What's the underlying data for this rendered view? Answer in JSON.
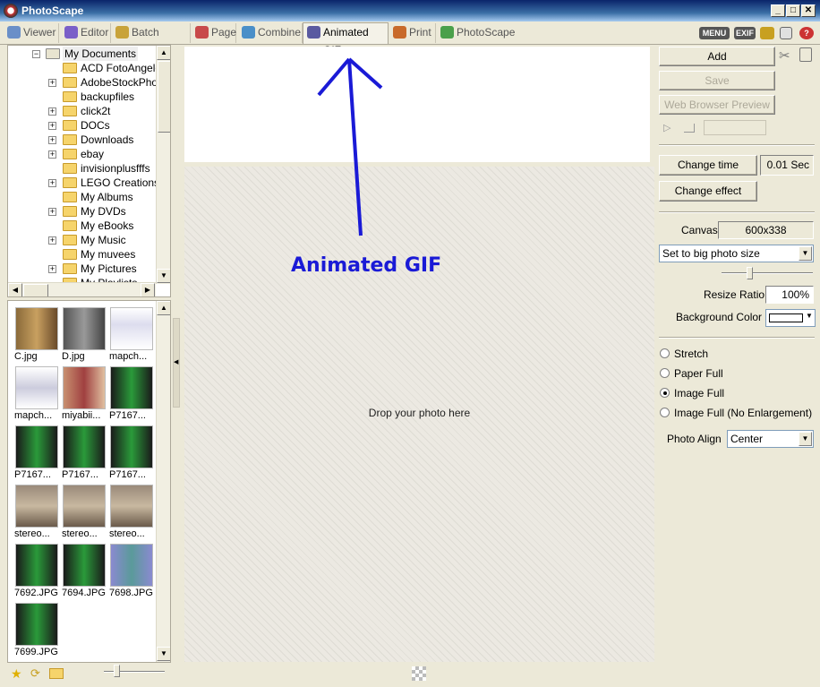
{
  "window": {
    "title": "PhotoScape"
  },
  "tabs": [
    {
      "label": "Viewer",
      "color": "#6a8fc8"
    },
    {
      "label": "Editor",
      "color": "#7a5fc8"
    },
    {
      "label": "Batch Editor",
      "color": "#c8a33a"
    },
    {
      "label": "Page",
      "color": "#c84a4a"
    },
    {
      "label": "Combine",
      "color": "#4a8fc8"
    },
    {
      "label": "Animated GIF",
      "color": "#5a5aa0"
    },
    {
      "label": "Print",
      "color": "#c86a2a"
    },
    {
      "label": "PhotoScape",
      "color": "#4aa04a"
    }
  ],
  "toolbar_icons": {
    "menu": "MENU",
    "exif": "EXIF"
  },
  "tree": {
    "root": "My Documents",
    "items": [
      {
        "label": "ACD FotoAngelo",
        "expandable": false
      },
      {
        "label": "AdobeStockPho",
        "expandable": true
      },
      {
        "label": "backupfiles",
        "expandable": false
      },
      {
        "label": "click2t",
        "expandable": true
      },
      {
        "label": "DOCs",
        "expandable": true
      },
      {
        "label": "Downloads",
        "expandable": true
      },
      {
        "label": "ebay",
        "expandable": true
      },
      {
        "label": "invisionplusfffs",
        "expandable": false
      },
      {
        "label": "LEGO Creations",
        "expandable": true
      },
      {
        "label": "My Albums",
        "expandable": false
      },
      {
        "label": "My DVDs",
        "expandable": true
      },
      {
        "label": "My eBooks",
        "expandable": false
      },
      {
        "label": "My Music",
        "expandable": true
      },
      {
        "label": "My muvees",
        "expandable": false
      },
      {
        "label": "My Pictures",
        "expandable": true
      },
      {
        "label": "My Playlists",
        "expandable": false
      }
    ]
  },
  "thumbnails": [
    {
      "caption": "C.jpg"
    },
    {
      "caption": "D.jpg"
    },
    {
      "caption": "mapch..."
    },
    {
      "caption": "mapch..."
    },
    {
      "caption": "miyabii..."
    },
    {
      "caption": "P7167..."
    },
    {
      "caption": "P7167..."
    },
    {
      "caption": "P7167..."
    },
    {
      "caption": "P7167..."
    },
    {
      "caption": "stereo..."
    },
    {
      "caption": "stereo..."
    },
    {
      "caption": "stereo..."
    },
    {
      "caption": "7692.JPG"
    },
    {
      "caption": "7694.JPG"
    },
    {
      "caption": "7698.JPG"
    },
    {
      "caption": "7699.JPG"
    }
  ],
  "canvas": {
    "drop_text": "Drop your photo here",
    "annotation": "Animated GIF"
  },
  "right_panel": {
    "add_label": "Add",
    "save_label": "Save",
    "preview_label": "Web Browser Preview",
    "change_time_label": "Change time",
    "time_value": "0.01 Sec",
    "change_effect_label": "Change effect",
    "canvas_label": "Canvas",
    "canvas_value": "600x338",
    "size_select": "Set to big photo size",
    "resize_ratio_label": "Resize Ratio",
    "resize_ratio_value": "100%",
    "bg_color_label": "Background Color",
    "bg_color": "#ffffff",
    "fit_options": [
      {
        "label": "Stretch",
        "selected": false
      },
      {
        "label": "Paper Full",
        "selected": false
      },
      {
        "label": "Image Full",
        "selected": true
      },
      {
        "label": "Image Full (No Enlargement)",
        "selected": false
      }
    ],
    "photo_align_label": "Photo Align",
    "photo_align_value": "Center"
  }
}
